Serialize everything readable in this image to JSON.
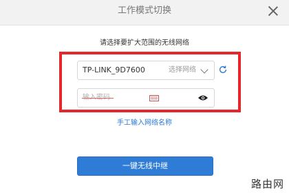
{
  "dialog": {
    "title": "工作模式切换",
    "subtitle": "请选择要扩大范围的无线网络"
  },
  "network": {
    "ssid": "TP-LINK_9D7600",
    "select_hint": "选择网络"
  },
  "password": {
    "placeholder": "输入密码"
  },
  "links": {
    "manual_entry": "手工输入网络名称"
  },
  "actions": {
    "repeat_button": "一键无线中继"
  },
  "watermark": {
    "text": "路由网"
  },
  "colors": {
    "highlight_border": "#e5262b",
    "primary": "#2f7cd6",
    "link": "#2b79d6"
  },
  "icons": {
    "close": "close-icon",
    "dropdown": "chevron-down-icon",
    "refresh": "refresh-icon",
    "keyboard": "keyboard-icon",
    "show_password": "eye-icon"
  }
}
